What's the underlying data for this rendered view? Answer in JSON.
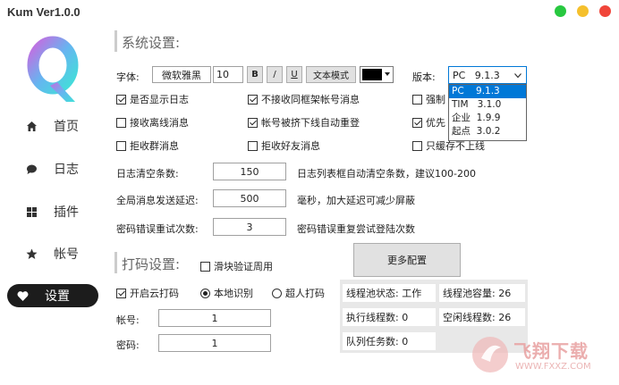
{
  "window": {
    "title": "Kum Ver1.0.0",
    "controls": [
      "green",
      "yellow",
      "red"
    ],
    "colors": {
      "green": "#28c840",
      "yellow": "#f5c02d",
      "red": "#f0453a"
    }
  },
  "logo": {
    "letter": "Q"
  },
  "nav": [
    {
      "label": "首页",
      "icon": "home-icon"
    },
    {
      "label": "日志",
      "icon": "chat-icon"
    },
    {
      "label": "插件",
      "icon": "grid-icon"
    },
    {
      "label": "帐号",
      "icon": "star-icon"
    },
    {
      "label": "设置",
      "icon": "heart-icon",
      "active": true
    }
  ],
  "settings": {
    "title": "系统设置:",
    "font_label": "字体:",
    "font_name": "微软雅黑",
    "font_size": "10",
    "bold": "B",
    "italic": "/",
    "underline": "U",
    "text_mode": "文本模式",
    "version_label": "版本:",
    "version_selected": "PC   9.1.3",
    "version_options": [
      "PC    9.1.3",
      "TIM   3.1.0",
      "企业  1.9.9",
      "起点  3.0.2"
    ],
    "checkboxes": [
      {
        "label": "是否显示日志",
        "checked": true
      },
      {
        "label": "不接收同框架帐号消息",
        "checked": true
      },
      {
        "label": "强制",
        "checked": false
      },
      {
        "label": "接收离线消息",
        "checked": false
      },
      {
        "label": "帐号被挤下线自动重登",
        "checked": true
      },
      {
        "label": "优先",
        "checked": true
      },
      {
        "label": "拒收群消息",
        "checked": false
      },
      {
        "label": "拒收好友消息",
        "checked": false
      },
      {
        "label": "只缓存不上线",
        "checked": false
      }
    ],
    "log_clear_label": "日志清空条数:",
    "log_clear_value": "150",
    "log_clear_hint": "日志列表框自动清空条数，建议100-200",
    "send_delay_label": "全局消息发送延迟:",
    "send_delay_value": "500",
    "send_delay_hint": "毫秒，加大延迟可减少屏蔽",
    "retry_label": "密码错误重试次数:",
    "retry_value": "3",
    "retry_hint": "密码错误重复尝试登陆次数",
    "more_config": "更多配置"
  },
  "captcha": {
    "title": "打码设置:",
    "slider_label": "滑块验证周用",
    "slider_checked": false,
    "cloud_label": "开启云打码",
    "cloud_checked": true,
    "local_label": "本地识别",
    "local_selected": true,
    "super_label": "超人打码",
    "super_selected": false,
    "account_label": "帐号:",
    "account_value": "1",
    "password_label": "密码:",
    "password_value": "1"
  },
  "thread_pool": {
    "status": "线程池状态: 工作",
    "capacity": "线程池容量: 26",
    "executing": "执行线程数: 0",
    "idle": "空闲线程数: 26",
    "queue": "队列任务数: 0"
  },
  "watermark": {
    "brand": "飞翔下载",
    "url": "WWW.FXXZ.COM"
  }
}
